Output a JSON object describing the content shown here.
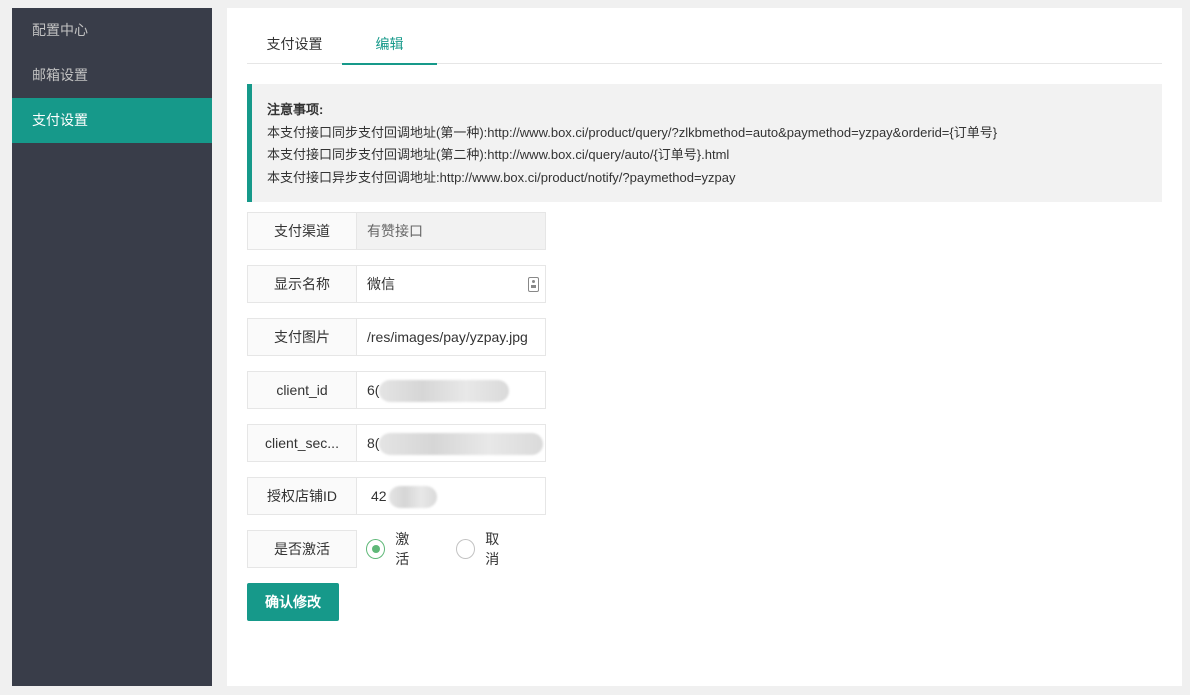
{
  "sidebar": {
    "items": [
      {
        "label": "配置中心"
      },
      {
        "label": "邮箱设置"
      },
      {
        "label": "支付设置"
      }
    ]
  },
  "tabs": [
    {
      "label": "支付设置"
    },
    {
      "label": "编辑"
    }
  ],
  "notice": {
    "title": "注意事项:",
    "lines": [
      "本支付接口同步支付回调地址(第一种):http://www.box.ci/product/query/?zlkbmethod=auto&paymethod=yzpay&orderid={订单号}",
      "本支付接口同步支付回调地址(第二种):http://www.box.ci/query/auto/{订单号}.html",
      "本支付接口异步支付回调地址:http://www.box.ci/product/notify/?paymethod=yzpay"
    ]
  },
  "form": {
    "channel": {
      "label": "支付渠道",
      "value": "有赞接口"
    },
    "display_name": {
      "label": "显示名称",
      "value": "微信"
    },
    "pay_image": {
      "label": "支付图片",
      "value": "/res/images/pay/yzpay.jpg"
    },
    "client_id": {
      "label": "client_id",
      "value": "6("
    },
    "client_secret": {
      "label": "client_sec...",
      "value": "8("
    },
    "shop_id": {
      "label": "授权店铺ID",
      "value": "42"
    },
    "active": {
      "label": "是否激活",
      "options": [
        {
          "label": "激活",
          "checked": true
        },
        {
          "label": "取消",
          "checked": false
        }
      ]
    },
    "submit_label": "确认修改"
  },
  "icons": {
    "contact": "contact-card-icon"
  },
  "colors": {
    "sidebar_bg": "#393d49",
    "accent": "#16998a",
    "radio_checked": "#5fb878"
  }
}
